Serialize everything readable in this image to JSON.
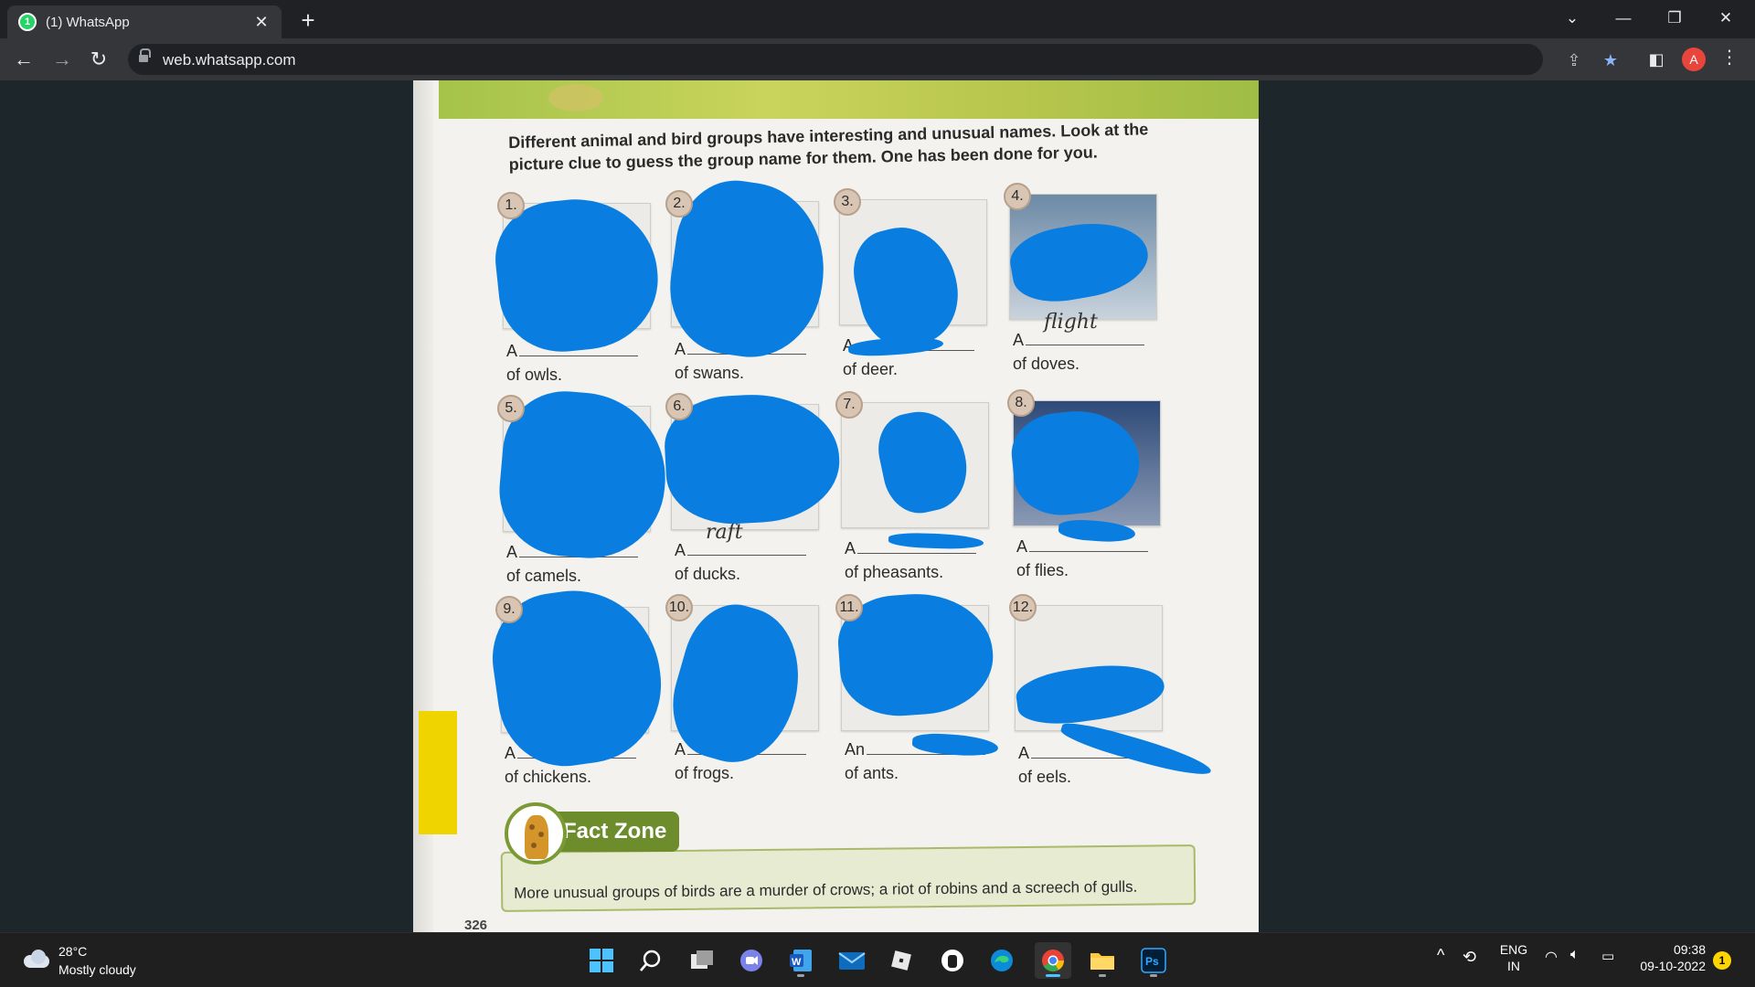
{
  "browser": {
    "tab_title": "(1) WhatsApp",
    "tab_badge": "1",
    "url": "web.whatsapp.com",
    "profile_initial": "A"
  },
  "page": {
    "instructions": "Different animal and bird groups have interesting and unusual names. Look at the picture clue to guess the group name for them. One has been done for you.",
    "items": [
      {
        "num": "1.",
        "article": "A",
        "label": "of owls.",
        "answer": ""
      },
      {
        "num": "2.",
        "article": "A",
        "label": "of swans.",
        "answer": ""
      },
      {
        "num": "3.",
        "article": "A",
        "label": "of deer.",
        "answer": ""
      },
      {
        "num": "4.",
        "article": "A",
        "label": "of doves.",
        "answer": "flight"
      },
      {
        "num": "5.",
        "article": "A",
        "label": "of camels.",
        "answer": ""
      },
      {
        "num": "6.",
        "article": "A",
        "label": "of ducks.",
        "answer": "raft"
      },
      {
        "num": "7.",
        "article": "A",
        "label": "of pheasants.",
        "answer": ""
      },
      {
        "num": "8.",
        "article": "A",
        "label": "of flies.",
        "answer": ""
      },
      {
        "num": "9.",
        "article": "A",
        "label": "of chickens.",
        "answer": ""
      },
      {
        "num": "10.",
        "article": "A",
        "label": "of frogs.",
        "answer": ""
      },
      {
        "num": "11.",
        "article": "An",
        "label": "of ants.",
        "answer": ""
      },
      {
        "num": "12.",
        "article": "A",
        "label": "of eels.",
        "answer": ""
      }
    ],
    "fact_title": "Fact Zone",
    "fact_text": "More unusual groups of birds are a murder of crows; a riot of robins and a screech of gulls.",
    "page_number": "326"
  },
  "taskbar": {
    "weather_temp": "28°C",
    "weather_desc": "Mostly cloudy",
    "language_1": "ENG",
    "language_2": "IN",
    "time": "09:38",
    "date": "09-10-2022",
    "notification_count": "1"
  },
  "colors": {
    "redaction": "#0a7ee0",
    "whatsapp_green": "#25d366",
    "fact_green": "#6d8c2c"
  }
}
